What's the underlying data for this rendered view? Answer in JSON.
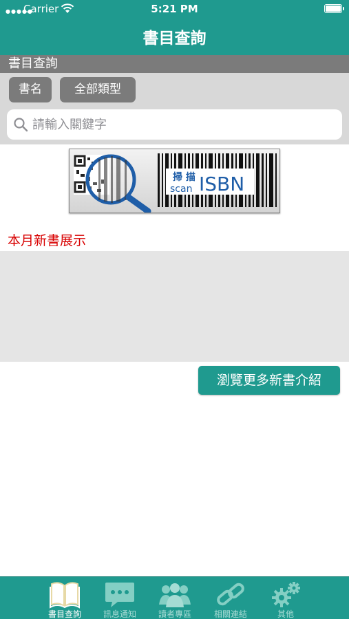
{
  "status_bar": {
    "carrier": "Carrier",
    "time": "5:21 PM"
  },
  "nav": {
    "title": "書目查詢"
  },
  "section": {
    "header": "書目查詢"
  },
  "filters": {
    "field_label": "書名",
    "type_label": "全部類型"
  },
  "search": {
    "placeholder": "請輸入關鍵字",
    "value": ""
  },
  "isbn_banner": {
    "line1": "掃 描",
    "line2": "scan",
    "brand": "ISBN"
  },
  "new_books": {
    "label": "本月新書展示",
    "browse_button": "瀏覽更多新書介紹"
  },
  "tabbar": {
    "items": [
      {
        "label": "書目查詢",
        "icon": "book-icon",
        "active": true
      },
      {
        "label": "訊息通知",
        "icon": "chat-bubble-icon",
        "active": false
      },
      {
        "label": "讀者專區",
        "icon": "people-icon",
        "active": false
      },
      {
        "label": "相關連結",
        "icon": "link-icon",
        "active": false
      },
      {
        "label": "其他",
        "icon": "gear-icon",
        "active": false
      }
    ]
  },
  "colors": {
    "accent": "#1f9a8f",
    "header_gray": "#7b7b7b",
    "search_bg": "#d8d8d8",
    "highlight_red": "#d80000"
  }
}
